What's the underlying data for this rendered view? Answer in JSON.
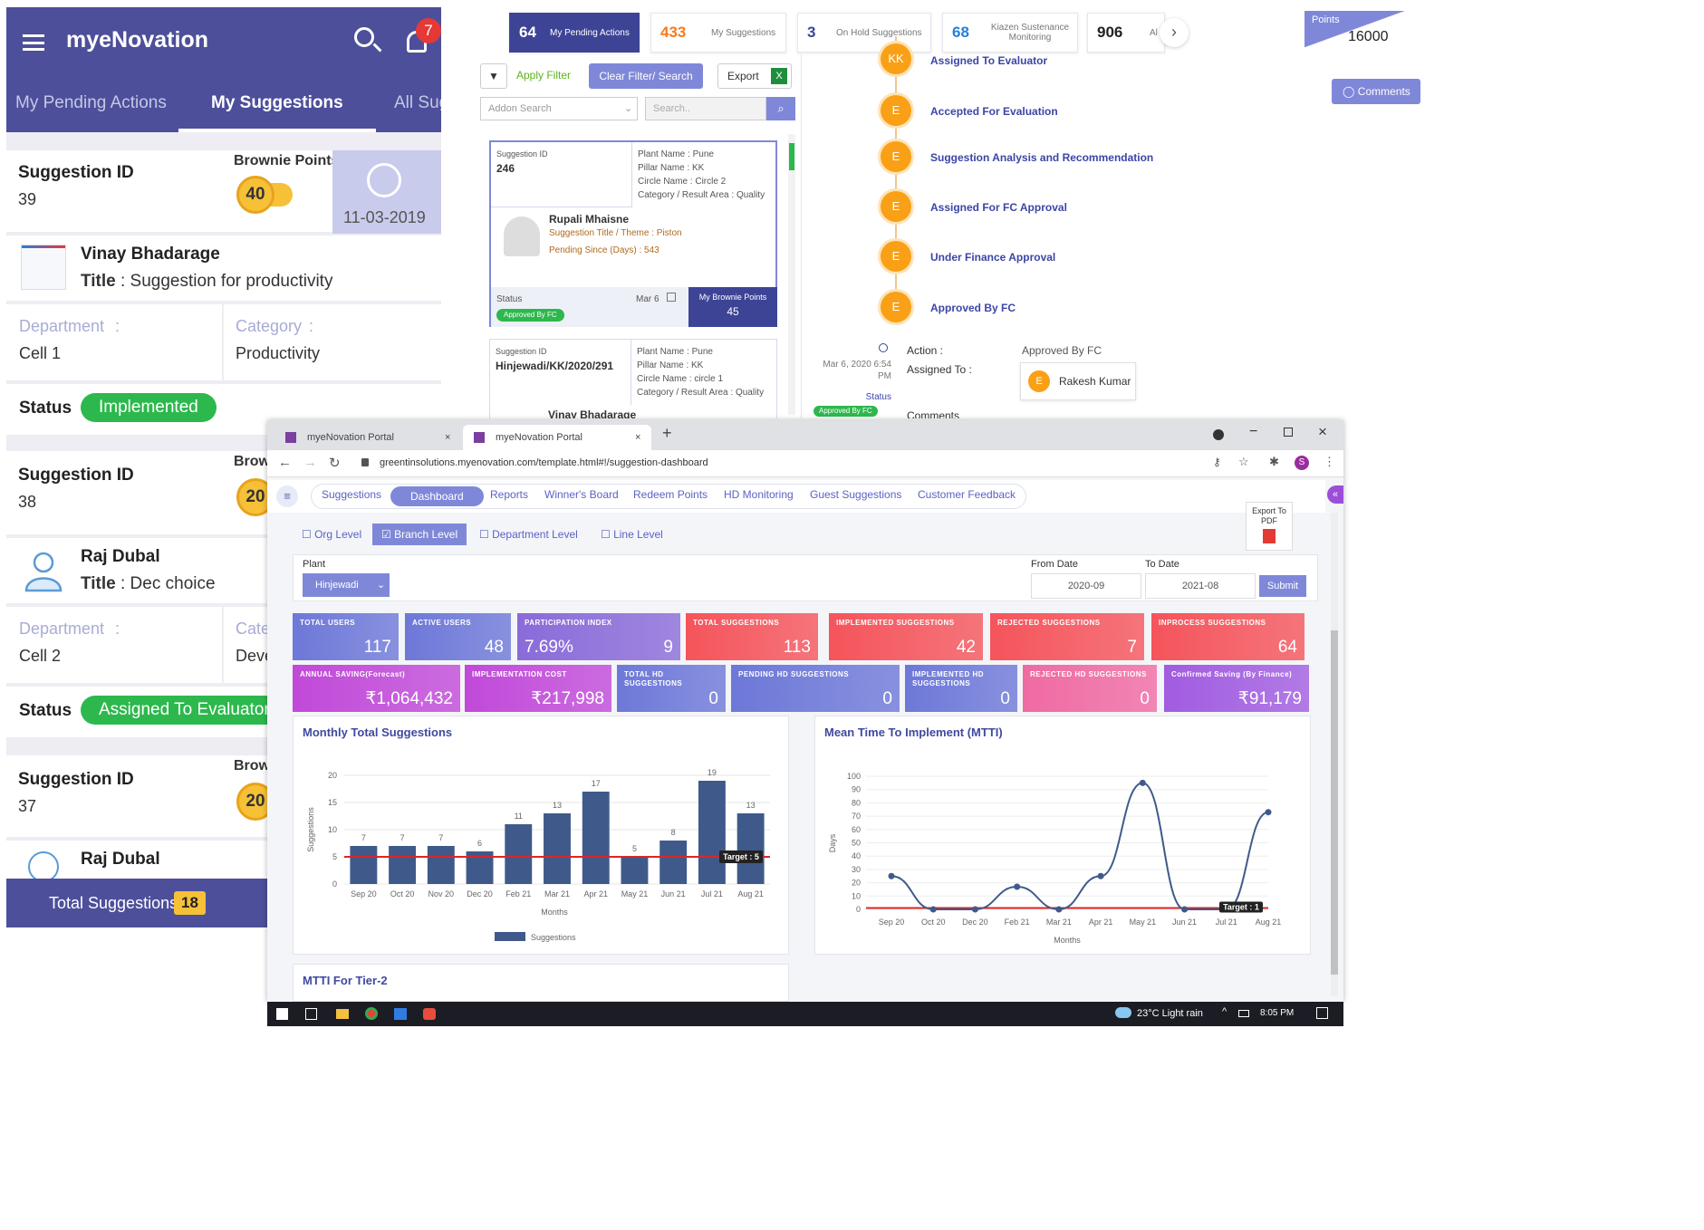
{
  "mobile": {
    "app_title": "myeNovation",
    "notification_count": "7",
    "tabs": [
      "My Pending Actions",
      "My Suggestions",
      "All Sug"
    ],
    "labels": {
      "suggestion_id": "Suggestion ID",
      "brownie_points": "Brownie Points",
      "brownie_short": "Brow",
      "title": "Title",
      "department": "Department",
      "category": "Category",
      "category_short": "Cate",
      "status": "Status"
    },
    "cards": [
      {
        "id": "39",
        "points": "40",
        "date": "11-03-2019",
        "name": "Vinay Bhadarage",
        "title": ": Suggestion for productivity",
        "department": "Cell 1",
        "category": "Productivity",
        "status": "Implemented"
      },
      {
        "id": "38",
        "points": "20",
        "name": "Raj Dubal",
        "title": ": Dec choice",
        "department": "Cell 2",
        "category": "Deve",
        "status": "Assigned To Evaluator"
      },
      {
        "id": "37",
        "points": "20",
        "name": "Raj Dubal"
      }
    ],
    "footer": {
      "label": "Total Suggestions",
      "count": "18"
    }
  },
  "desktop_top": {
    "stats": [
      {
        "value": "64",
        "label": "My Pending Actions"
      },
      {
        "value": "433",
        "label": "My Suggestions"
      },
      {
        "value": "3",
        "label": "On Hold Suggestions"
      },
      {
        "value": "68",
        "label": "Kiazen Sustenance Monitoring"
      },
      {
        "value": "906",
        "label": "Al"
      }
    ],
    "points": {
      "label": "Points",
      "value": "16000"
    },
    "comments_button": "Comments",
    "toolbar": {
      "apply": "Apply Filter",
      "clear": "Clear Filter/ Search",
      "export": "Export",
      "addon_placeholder": "Addon Search",
      "search_placeholder": "Search.."
    },
    "card1": {
      "sid_label": "Suggestion ID",
      "sid": "246",
      "plant": "Plant Name : Pune",
      "pillar": "Pillar Name : KK",
      "circle": "Circle Name : Circle 2",
      "category": "Category / Result Area : Quality",
      "person": "Rupali Mhaisne",
      "theme": "Suggestion Title / Theme : Piston",
      "pending": "Pending Since (Days) : 543",
      "status_label": "Status",
      "status": "Approved By FC",
      "date": "Mar 6",
      "bp_label": "My Brownie Points",
      "bp": "45"
    },
    "card2": {
      "sid_label": "Suggestion ID",
      "sid": "Hinjewadi/KK/2020/291",
      "plant": "Plant Name : Pune",
      "pillar": "Pillar Name : KK",
      "circle": "Circle Name : circle 1",
      "category": "Category / Result Area : Quality",
      "person": "Vinay Bhadarage"
    },
    "timeline": [
      {
        "badge": "KK",
        "label": "Assigned To Evaluator"
      },
      {
        "badge": "E",
        "label": "Accepted For Evaluation"
      },
      {
        "badge": "E",
        "label": "Suggestion Analysis and Recommendation"
      },
      {
        "badge": "E",
        "label": "Assigned For FC Approval"
      },
      {
        "badge": "E",
        "label": "Under Finance Approval"
      },
      {
        "badge": "E",
        "label": "Approved By FC"
      }
    ],
    "action": {
      "datetime": "Mar 6, 2020 6:54 PM",
      "status_label": "Status",
      "status": "Approved By FC",
      "action_label": "Action :",
      "action_value": "Approved By FC",
      "assigned_label": "Assigned To :",
      "assignee_badge": "E",
      "assignee": "Rakesh Kumar",
      "comments": "Comments"
    }
  },
  "browser": {
    "tabs": [
      "myeNovation Portal",
      "myeNovation Portal"
    ],
    "url": "greentinsolutions.myenovation.com/template.html#!/suggestion-dashboard",
    "profile_letter": "S",
    "nav": [
      "Suggestions",
      "Dashboard",
      "Reports",
      "Winner's Board",
      "Redeem Points",
      "HD Monitoring",
      "Guest Suggestions",
      "Customer Feedback"
    ],
    "levels": [
      "Org Level",
      "Branch Level",
      "Department Level",
      "Line Level"
    ],
    "export_pdf": "Export To PDF",
    "filter": {
      "plant_label": "Plant",
      "plant": "Hinjewadi",
      "from_label": "From Date",
      "from": "2020-09",
      "to_label": "To Date",
      "to": "2021-08",
      "submit": "Submit"
    },
    "tiles_row1": [
      {
        "label": "TOTAL USERS",
        "value": "117",
        "color": "#6d78d8"
      },
      {
        "label": "ACTIVE USERS",
        "value": "48",
        "color": "#6d78d8"
      },
      {
        "label": "PARTICIPATION INDEX",
        "value": "7.69%",
        "value2": "9",
        "color": "#8a6bd9"
      },
      {
        "label": "TOTAL SUGGESTIONS",
        "value": "113",
        "color": "#f5545b"
      },
      {
        "label": "IMPLEMENTED SUGGESTIONS",
        "value": "42",
        "color": "#f5545b"
      },
      {
        "label": "REJECTED SUGGESTIONS",
        "value": "7",
        "color": "#f5545b"
      },
      {
        "label": "INPROCESS SUGGESTIONS",
        "value": "64",
        "color": "#f5545b"
      }
    ],
    "tiles_row2": [
      {
        "label": "ANNUAL SAVING(Forecast)",
        "value": "₹1,064,432",
        "color": "#c149d9"
      },
      {
        "label": "IMPLEMENTATION COST",
        "value": "₹217,998",
        "color": "#c149d9"
      },
      {
        "label": "TOTAL HD SUGGESTIONS",
        "value": "0",
        "color": "#6d78d8"
      },
      {
        "label": "PENDING HD SUGGESTIONS",
        "value": "0",
        "color": "#6d78d8"
      },
      {
        "label": "IMPLEMENTED HD SUGGESTIONS",
        "value": "0",
        "color": "#6d78d8"
      },
      {
        "label": "REJECTED HD SUGGESTIONS",
        "value": "0",
        "color": "#f06aa2"
      },
      {
        "label": "Confirmed Saving (By Finance)",
        "value": "₹91,179",
        "color": "#a15ce0"
      }
    ],
    "panel3_title": "MTTI For Tier-2",
    "taskbar": {
      "weather": "23°C Light rain",
      "time": "8:05 PM"
    }
  },
  "chart_data": [
    {
      "type": "bar",
      "title": "Monthly Total Suggestions",
      "xlabel": "Months",
      "ylabel": "Suggestions",
      "categories": [
        "Sep 20",
        "Oct 20",
        "Nov 20",
        "Dec 20",
        "Feb 21",
        "Mar 21",
        "Apr 21",
        "May 21",
        "Jun 21",
        "Jul 21",
        "Aug 21"
      ],
      "series": [
        {
          "name": "Suggestions",
          "values": [
            7,
            7,
            7,
            6,
            11,
            13,
            17,
            5,
            8,
            19,
            13
          ]
        }
      ],
      "target": 5,
      "target_label": "Target : 5",
      "ylim": [
        0,
        20
      ],
      "yticks": [
        0,
        5,
        10,
        15,
        20
      ],
      "colors": {
        "bar": "#3f5a8a",
        "target": "#e02424"
      }
    },
    {
      "type": "line",
      "title": "Mean Time To Implement (MTTI)",
      "xlabel": "Months",
      "ylabel": "Days",
      "categories": [
        "Sep 20",
        "Oct 20",
        "Dec 20",
        "Feb 21",
        "Mar 21",
        "Apr 21",
        "May 21",
        "Jun 21",
        "Jul 21",
        "Aug 21"
      ],
      "values": [
        25,
        0,
        0,
        17,
        0,
        25,
        95,
        0,
        0,
        73
      ],
      "target": 1,
      "target_label": "Target : 1",
      "ylim": [
        0,
        100
      ],
      "yticks": [
        0,
        10,
        20,
        30,
        40,
        50,
        60,
        70,
        80,
        90,
        100
      ],
      "colors": {
        "line": "#3f5a8a",
        "target": "#e02424"
      }
    }
  ]
}
